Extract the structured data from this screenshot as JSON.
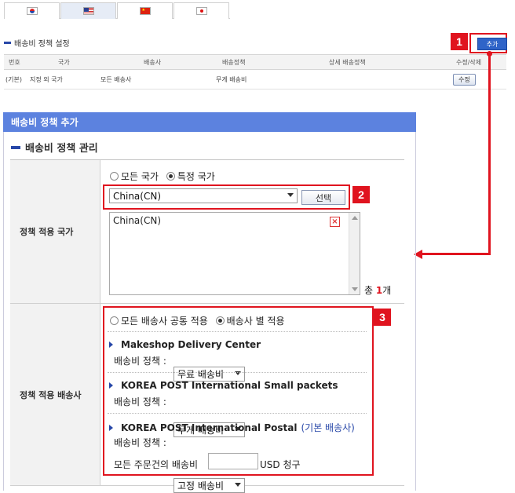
{
  "tabs": [
    {
      "flag": "korea-flag-icon",
      "active": false
    },
    {
      "flag": "usa-flag-icon",
      "active": true
    },
    {
      "flag": "china-flag-icon",
      "active": false
    },
    {
      "flag": "japan-flag-icon",
      "active": false
    }
  ],
  "policy_section": {
    "title": "배송비 정책 설정",
    "add_label": "추가",
    "columns": [
      "번호",
      "국가",
      "배송사",
      "배송정책",
      "상세 배송정책",
      "수정/삭제"
    ],
    "rows": [
      {
        "no": "(기본)",
        "country": "지정 외 국가",
        "carrier": "모든 배송사",
        "policy": "무게 배송비",
        "detail": "",
        "edit_label": "수정"
      }
    ]
  },
  "dialog": {
    "header": "배송비 정책 추가",
    "title": "배송비 정책 관리",
    "country_row": {
      "label": "정책 적용 국가",
      "radio_all": "모든 국가",
      "radio_specific": "특정 국가",
      "selected_country": "China(CN)",
      "select_button": "선택",
      "list_items": [
        "China(CN)"
      ],
      "total_prefix": "총",
      "total_count": "1",
      "total_suffix": "개"
    },
    "carrier_row": {
      "label": "정책 적용 배송사",
      "radio_common": "모든 배송사 공통 적용",
      "radio_each": "배송사 별 적용",
      "policy_label": "배송비 정책 :",
      "carriers": [
        {
          "name": "Makeshop Delivery Center",
          "note": "",
          "policy": "무료 배송비"
        },
        {
          "name": "KOREA POST International Small packets",
          "note": "",
          "policy": "무게 배송비"
        },
        {
          "name": "KOREA POST International Postal",
          "note": "(기본 배송사)",
          "policy": "고정 배송비"
        }
      ],
      "fee_prefix": "모든 주문건의 배송비",
      "fee_value": "",
      "fee_suffix": "USD 청구"
    }
  },
  "callouts": [
    "1",
    "2",
    "3"
  ],
  "colors": {
    "accent": "#5c82df",
    "callout": "#e0141f",
    "brand_bar": "#2747a8"
  }
}
